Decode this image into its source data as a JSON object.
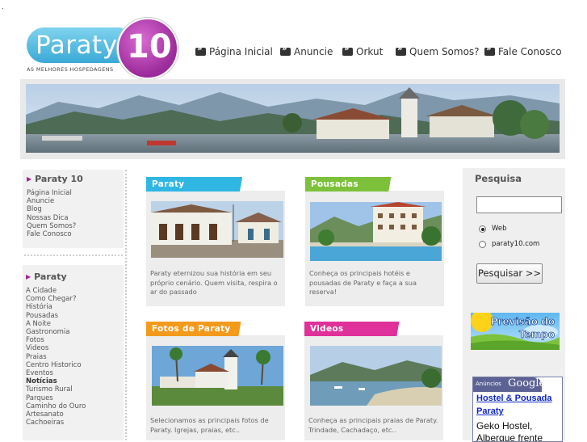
{
  "brand": {
    "name": "Paraty",
    "number": "10",
    "tagline": "AS MELHORES HOSPEDAGENS"
  },
  "topnav": [
    "Página Inicial",
    "Anuncie",
    "Orkut",
    "Quem Somos?",
    "Fale Conosco"
  ],
  "left": {
    "section1": {
      "title": "Paraty 10",
      "items": [
        "Página Inicial",
        "Anuncie",
        "Blog",
        "Nossas Dica",
        "Quem Somos?",
        "Fale Conosco"
      ]
    },
    "section2": {
      "title": "Paraty",
      "items": [
        "A Cidade",
        "Como Chegar?",
        "História",
        "Pousadas",
        "A Noite",
        "Gastronomia",
        "Fotos",
        "Videos",
        "Praias",
        "Centro Historico",
        "Eventos",
        "Notícias",
        "Turismo Rural",
        "Parques",
        "Caminho do Ouro",
        "Artesanato",
        "Cachoeiras"
      ]
    }
  },
  "cards": [
    {
      "title": "Paraty",
      "text": "Paraty eternizou sua história em seu próprio cenário. Quem visita, respira o ar do passado",
      "color": "#2fb6e2"
    },
    {
      "title": "Pousadas",
      "text": "Conheça os principais hotéis e pousadas de Paraty e faça a sua reserva!",
      "color": "#7dc13a"
    },
    {
      "title": "Fotos de Paraty",
      "text": "Selecionamos as principais fotos de Paraty. Igrejas, praias, etc..",
      "color": "#f39a1c"
    },
    {
      "title": "Videos",
      "text": "Conheça as principais praias de Paraty. Trindade, Cachadaço, etc..",
      "color": "#e0309a"
    }
  ],
  "search": {
    "label": "Pesquisa",
    "value": "",
    "options": [
      "Web",
      "paraty10.com"
    ],
    "selected": "Web",
    "button": "Pesquisar >>"
  },
  "weather": {
    "line1": "Previsão do",
    "line2": "Tempo"
  },
  "ads": {
    "label": "Anúncios",
    "brand": "Google",
    "link_line1": "Hostel & Pousada",
    "link_line2": "Paraty",
    "text_line1": "Geko Hostel,",
    "text_line2": "Albergue frente"
  }
}
